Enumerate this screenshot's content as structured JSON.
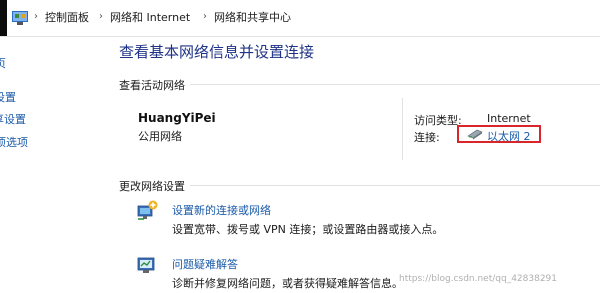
{
  "breadcrumb": {
    "items": [
      "控制面板",
      "网络和 Internet",
      "网络和共享中心"
    ],
    "separator": "›"
  },
  "sidebar": {
    "items": [
      "页",
      "设置",
      "享设置",
      "项选项"
    ]
  },
  "main": {
    "title": "查看基本网络信息并设置连接",
    "active_networks_label": "查看活动网络",
    "network": {
      "name": "HuangYiPei",
      "type": "公用网络",
      "access_type_label": "访问类型:",
      "access_type_value": "Internet",
      "connection_label": "连接:",
      "connection_value": "以太网 2"
    },
    "change_settings_label": "更改网络设置",
    "tasks": [
      {
        "link": "设置新的连接或网络",
        "desc": "设置宽带、拨号或 VPN 连接；或设置路由器或接入点。"
      },
      {
        "link": "问题疑难解答",
        "desc": "诊断并修复网络问题，或者获得疑难解答信息。"
      }
    ]
  },
  "watermark": "https://blog.csdn.net/qq_42838291",
  "colors": {
    "title": "#1e3287",
    "link": "#1a5aa8",
    "highlight_box": "#d8262c"
  }
}
